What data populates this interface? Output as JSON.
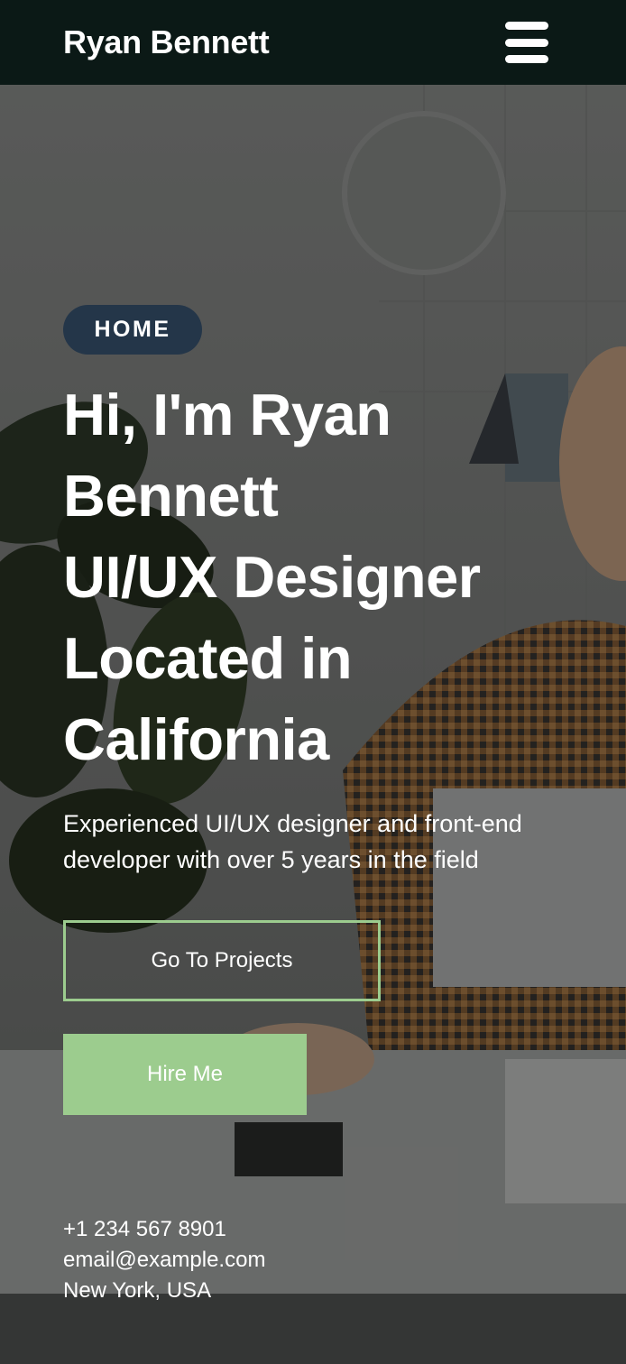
{
  "header": {
    "brand": "Ryan Bennett",
    "menu_icon": "hamburger-menu-icon"
  },
  "hero": {
    "badge": "HOME",
    "headline_lines": [
      "Hi, I'm Ryan",
      "Bennett",
      "UI/UX Designer",
      "Located in",
      "California"
    ],
    "subtitle": "Experienced UI/UX designer and front-end developer with over 5 years in the field",
    "primary_button": "Go To Projects",
    "secondary_button": "Hire Me"
  },
  "contact": {
    "phone": "+1 234 567 8901",
    "email": "email@example.com",
    "location": "New York, USA"
  },
  "colors": {
    "header_bg": "#0b1916",
    "badge_bg": "#243649",
    "accent_green": "#9ccc8e"
  }
}
